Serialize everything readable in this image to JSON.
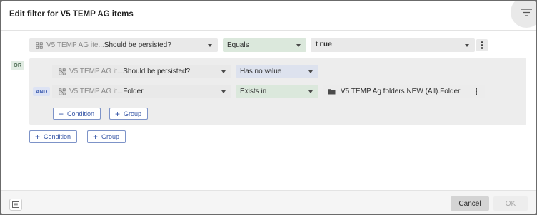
{
  "dialog": {
    "title": "Edit filter for V5 TEMP AG items"
  },
  "root_filter": {
    "condition": {
      "property_source": "V5 TEMP AG ite...",
      "property_name": "Should be persisted?",
      "operator": "Equals",
      "value": "true"
    },
    "logic_badge": "OR",
    "group": {
      "logic_badge": "AND",
      "conditions": [
        {
          "property_source": "V5 TEMP AG it...",
          "property_name": "Should be persisted?",
          "operator": "Has no value"
        },
        {
          "property_source": "V5 TEMP AG it...",
          "property_name": "Folder",
          "operator": "Exists in",
          "value": "V5 TEMP Ag folders NEW (All).Folder"
        }
      ],
      "add_condition_label": "Condition",
      "add_group_label": "Group"
    },
    "add_condition_label": "Condition",
    "add_group_label": "Group"
  },
  "footer": {
    "cancel_label": "Cancel",
    "ok_label": "OK"
  },
  "icons": {
    "filter": "filter-lines-icon",
    "property": "grid-link-icon",
    "folder": "folder-icon",
    "notes": "notes-icon",
    "more": "kebab-menu-icon",
    "dropdown": "caret-down-icon",
    "add": "plus-icon"
  },
  "colors": {
    "accent": "#3555a6",
    "operator_green": "#dbe8dc",
    "operator_blue": "#dde2ee",
    "or_badge": "#e1ece3",
    "and_badge": "#dde3f4"
  }
}
